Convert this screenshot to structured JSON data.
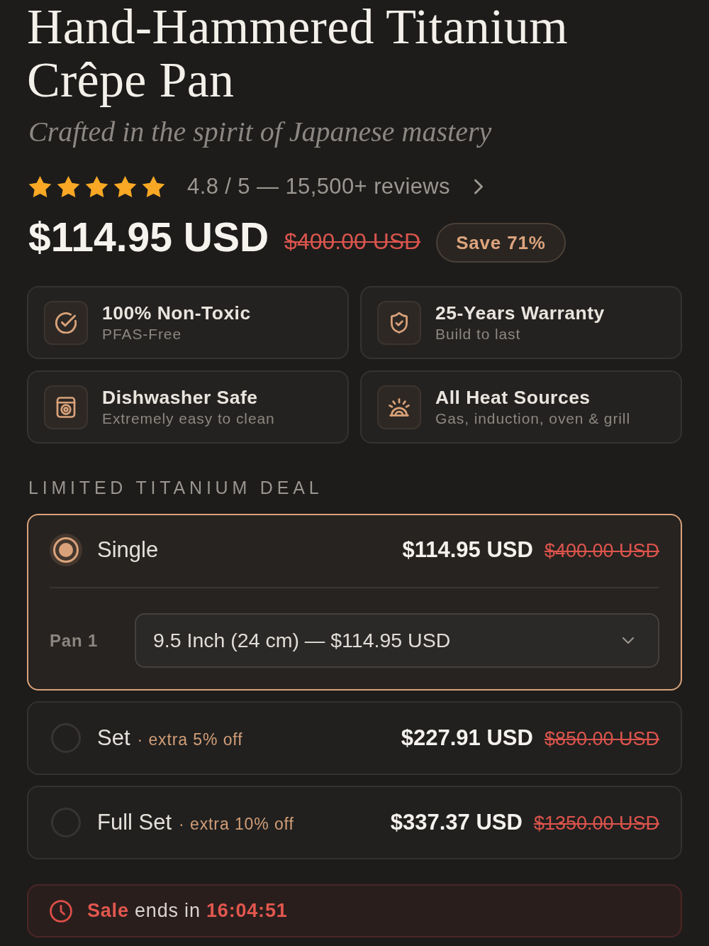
{
  "product": {
    "title": "Hand-Hammered Titanium Crêpe Pan",
    "tagline": "Crafted in the spirit of Japanese mastery",
    "rating": {
      "stars": 5,
      "summary": "4.8 / 5 — 15,500+ reviews"
    },
    "price": "$114.95 USD",
    "compare_at_price": "$400.00 USD",
    "save_badge": "Save 71%"
  },
  "features": [
    {
      "title": "100% Non-Toxic",
      "subtitle": "PFAS-Free"
    },
    {
      "title": "25-Years Warranty",
      "subtitle": "Build to last"
    },
    {
      "title": "Dishwasher Safe",
      "subtitle": "Extremely easy to clean"
    },
    {
      "title": "All Heat Sources",
      "subtitle": "Gas, induction, oven & grill"
    }
  ],
  "deal": {
    "heading": "LIMITED TITANIUM DEAL",
    "options": [
      {
        "label": "Single",
        "selected": true,
        "price": "$114.95 USD",
        "compare_at_price": "$400.00 USD",
        "variants": [
          {
            "label": "Pan 1",
            "value": "9.5 Inch (24 cm) — $114.95 USD"
          }
        ]
      },
      {
        "label": "Set",
        "note": "· extra 5% off",
        "selected": false,
        "price": "$227.91 USD",
        "compare_at_price": "$850.00 USD"
      },
      {
        "label": "Full Set",
        "note": "· extra 10% off",
        "selected": false,
        "price": "$337.37 USD",
        "compare_at_price": "$1350.00 USD"
      }
    ]
  },
  "sale_banner": {
    "text": "**Sale** ends in **16:04:51**"
  }
}
